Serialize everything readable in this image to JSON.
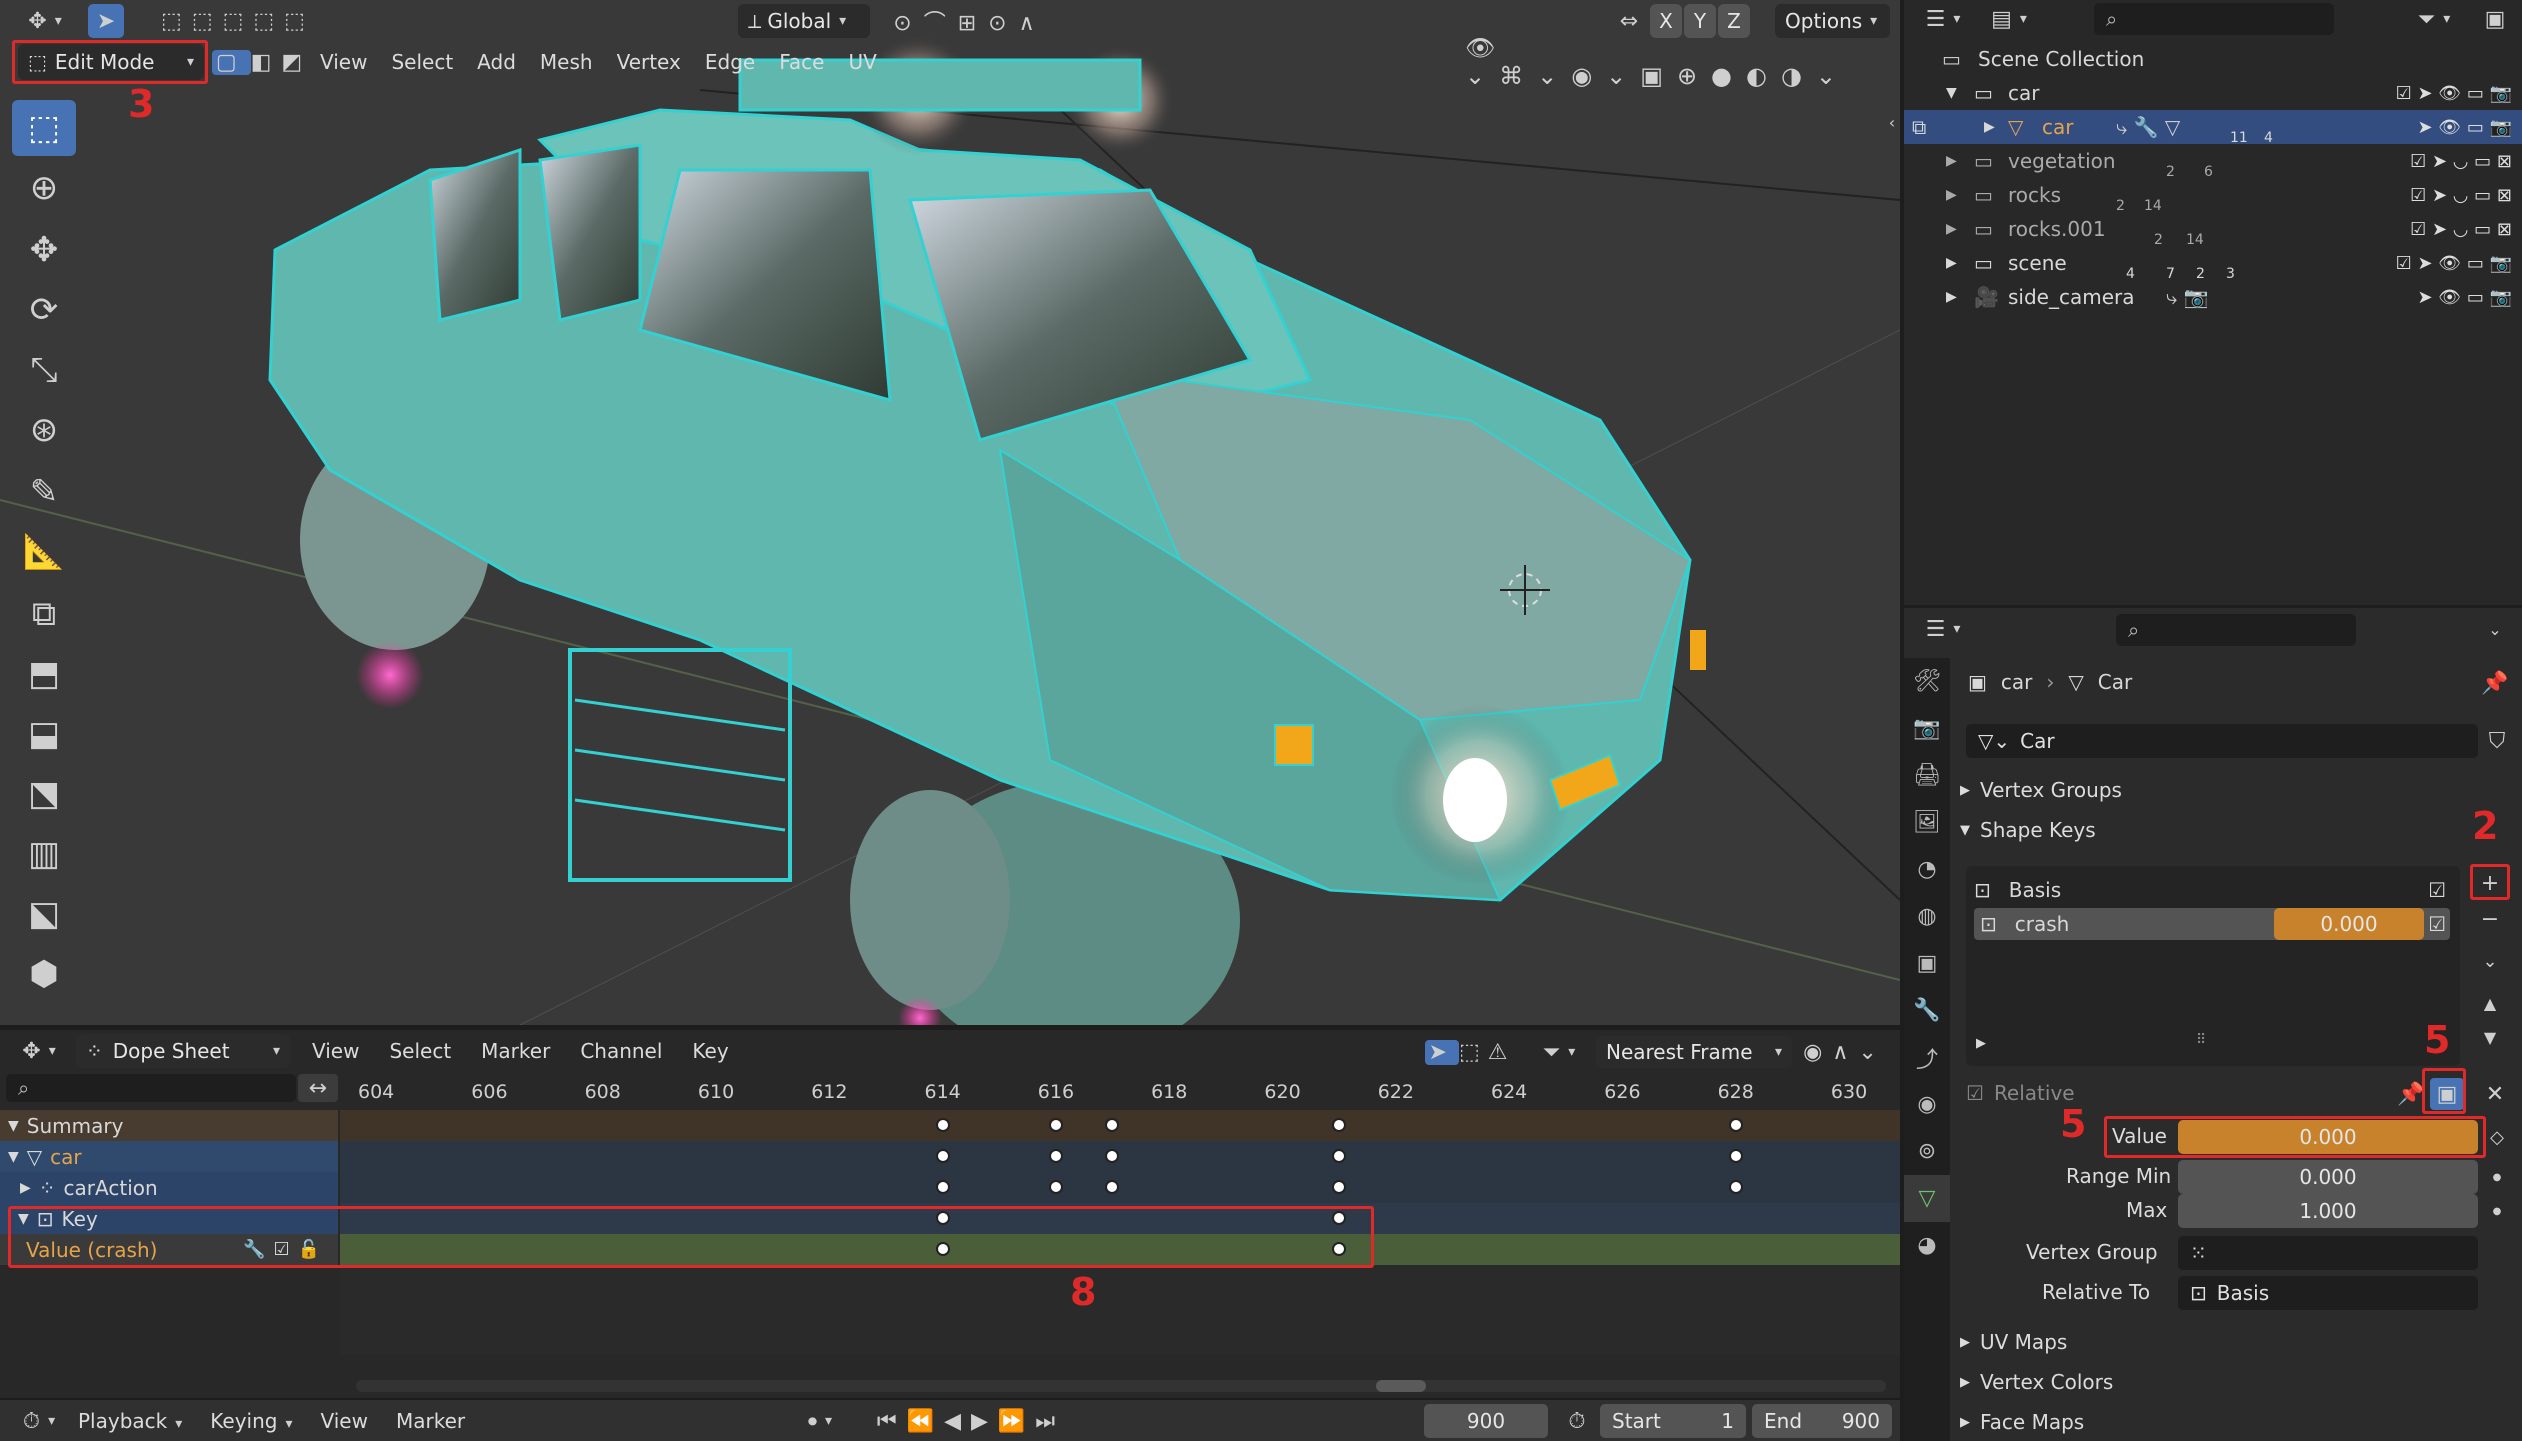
{
  "viewport": {
    "orientation": "Global",
    "axes": [
      "X",
      "Y",
      "Z"
    ],
    "options_label": "Options",
    "mode": "Edit Mode",
    "menu": [
      "View",
      "Select",
      "Add",
      "Mesh",
      "Vertex",
      "Edge",
      "Face",
      "UV"
    ],
    "tools": [
      "select-box-icon",
      "cursor-icon",
      "move-icon",
      "rotate-icon",
      "scale-icon",
      "transform-icon",
      "annotate-icon",
      "measure-icon",
      "add-cube-icon",
      "extrude-icon",
      "inset-icon",
      "bevel-icon",
      "loop-cut-icon",
      "knife-icon",
      "poly-build-icon"
    ]
  },
  "outliner": {
    "search_placeholder": "",
    "rows": [
      {
        "name": "Scene Collection",
        "indent": 0,
        "selected": false
      },
      {
        "name": "car",
        "indent": 1,
        "selected": false,
        "badges": []
      },
      {
        "name": "car",
        "indent": 2,
        "selected": true,
        "badges": [
          "11",
          "4"
        ]
      },
      {
        "name": "vegetation",
        "indent": 1,
        "selected": false,
        "badges": [
          "2",
          "6"
        ]
      },
      {
        "name": "rocks",
        "indent": 1,
        "selected": false,
        "badges": [
          "2",
          "14"
        ]
      },
      {
        "name": "rocks.001",
        "indent": 1,
        "selected": false,
        "badges": [
          "2",
          "14"
        ]
      },
      {
        "name": "scene",
        "indent": 1,
        "selected": false,
        "badges": [
          "4",
          "7",
          "2",
          "3"
        ]
      },
      {
        "name": "side_camera",
        "indent": 1,
        "selected": false,
        "badges": []
      }
    ]
  },
  "properties": {
    "breadcrumb_object": "car",
    "breadcrumb_data": "Car",
    "mesh_name": "Car",
    "sections": {
      "vertex_groups": "Vertex Groups",
      "shape_keys": "Shape Keys",
      "uv_maps": "UV Maps",
      "vertex_colors": "Vertex Colors",
      "face_maps": "Face Maps"
    },
    "shape_keys": [
      {
        "name": "Basis",
        "value": "",
        "checked": true
      },
      {
        "name": "crash",
        "value": "0.000",
        "checked": true
      }
    ],
    "relative_label": "Relative",
    "value_label": "Value",
    "value": "0.000",
    "range_min_label": "Range Min",
    "range_min": "0.000",
    "max_label": "Max",
    "max": "1.000",
    "vertex_group_label": "Vertex Group",
    "relative_to_label": "Relative To",
    "relative_to": "Basis"
  },
  "dopesheet": {
    "mode": "Dope Sheet",
    "menu": [
      "View",
      "Select",
      "Marker",
      "Channel",
      "Key"
    ],
    "snap": "Nearest Frame",
    "frames": [
      "604",
      "606",
      "608",
      "610",
      "612",
      "614",
      "616",
      "618",
      "620",
      "622",
      "624",
      "626",
      "628",
      "630"
    ],
    "channels": [
      {
        "name": "Summary",
        "keys": [
          614,
          616,
          617,
          621,
          628
        ]
      },
      {
        "name": "car",
        "keys": [
          614,
          616,
          617,
          621,
          628
        ]
      },
      {
        "name": "carAction",
        "keys": [
          614,
          616,
          617,
          621,
          628
        ]
      },
      {
        "name": "Key",
        "keys": [
          614,
          621
        ]
      },
      {
        "name": "Value (crash)",
        "keys": [
          614,
          621
        ]
      }
    ]
  },
  "timeline": {
    "menu": [
      "Playback",
      "Keying",
      "View",
      "Marker"
    ],
    "current_frame": "900",
    "start_label": "Start",
    "start": "1",
    "end_label": "End",
    "end": "900"
  },
  "annotations": [
    "3",
    "2",
    "5",
    "5",
    "8"
  ],
  "colors": {
    "accent": "#4772b3",
    "slider_orange": "#c8822b",
    "mesh_cyan": "#33d1d1",
    "highlight_red": "#e02a2a"
  }
}
